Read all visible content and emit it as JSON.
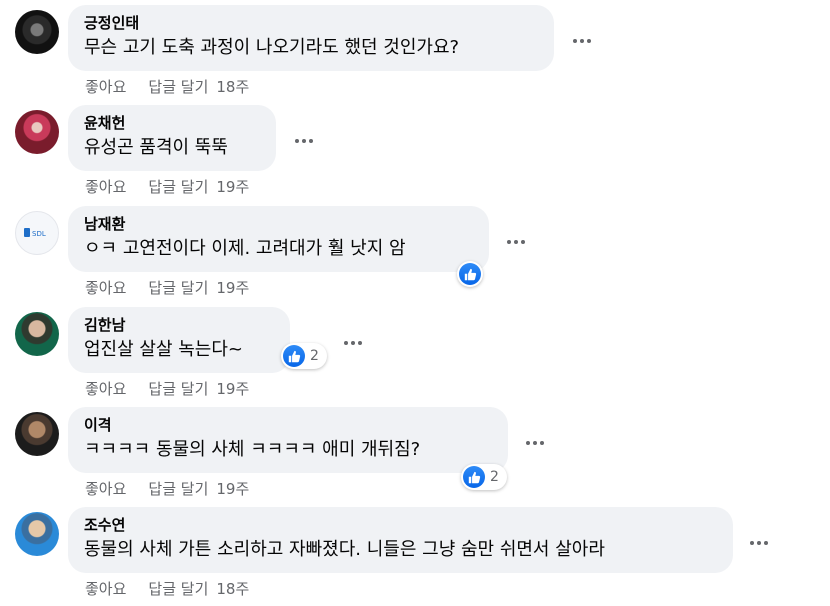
{
  "comments": [
    {
      "author": "긍정인태",
      "text": "무슨 고기 도축 과정이 나오기라도 했던 것인가요?",
      "like": "좋아요",
      "reply": "답글 달기",
      "time": "18주",
      "reactions": null
    },
    {
      "author": "윤채헌",
      "text": "유성곤 품격이 뚝뚝",
      "like": "좋아요",
      "reply": "답글 달기",
      "time": "19주",
      "reactions": null
    },
    {
      "author": "남재환",
      "text": "ㅇㅋ 고연전이다 이제. 고려대가 훨 낫지 암",
      "like": "좋아요",
      "reply": "답글 달기",
      "time": "19주",
      "reactions": {
        "icon": "like-icon",
        "count": ""
      }
    },
    {
      "author": "김한남",
      "text": "업진살 살살 녹는다~",
      "like": "좋아요",
      "reply": "답글 달기",
      "time": "19주",
      "reactions": {
        "icon": "like-icon",
        "count": "2"
      }
    },
    {
      "author": "이격",
      "text": "ㅋㅋㅋㅋ 동물의 사체 ㅋㅋㅋㅋ 애미 개뒤짐?",
      "like": "좋아요",
      "reply": "답글 달기",
      "time": "19주",
      "reactions": {
        "icon": "like-icon",
        "count": "2"
      }
    },
    {
      "author": "조수연",
      "text": "동물의 사체 가튼 소리하고 자빠졌다. 니들은 그냥 숨만 쉬면서 살아라",
      "like": "좋아요",
      "reply": "답글 달기",
      "time": "18주",
      "reactions": null
    }
  ],
  "colors": {
    "bubble": "#f0f2f5",
    "secondary_text": "#65676b",
    "like_blue": "#1877f2"
  }
}
